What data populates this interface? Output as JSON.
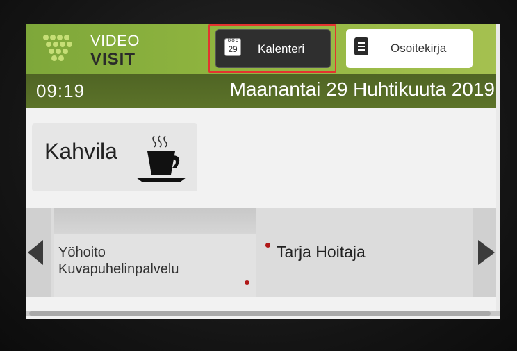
{
  "app": {
    "logo_line1": "VIDEO",
    "logo_line2": "VISIT",
    "accent_color": "#8fb43f",
    "header_dark_color": "#5c7329"
  },
  "toolbar": {
    "calendar": {
      "icon": "calendar-icon",
      "icon_day": "29",
      "label": "Kalenteri"
    },
    "address_book": {
      "icon": "document-icon",
      "label": "Osoitekirja"
    }
  },
  "datebar": {
    "time": "09:19",
    "date": "Maanantai 29 Huhtikuuta 2019"
  },
  "cafe": {
    "label": "Kahvila",
    "icon": "coffee-cup-icon"
  },
  "contacts": {
    "items": [
      {
        "line1": "Yöhoito",
        "line2": "Kuvapuhelinpalvelu",
        "status": "offline"
      },
      {
        "name": "Tarja Hoitaja",
        "status": "offline"
      }
    ],
    "status_color": "#b01818"
  }
}
